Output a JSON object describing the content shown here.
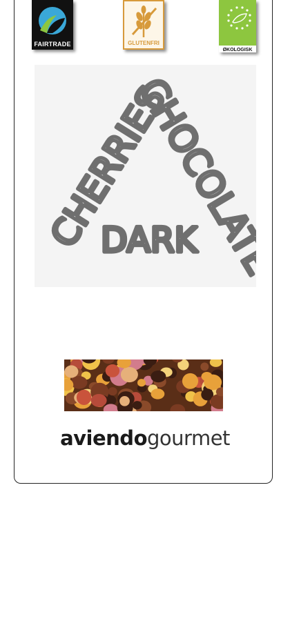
{
  "badges": {
    "fairtrade": {
      "label": "FAIRTRADE",
      "icon": "fairtrade-icon",
      "colors": {
        "background": "#111111",
        "blue": "#3aa8d8",
        "green": "#8cc63f"
      }
    },
    "glutenfree": {
      "label": "GLUTENFRI",
      "icon": "wheat-icon",
      "colors": {
        "accent": "#d79a3b"
      }
    },
    "organic": {
      "label": "ØKOLOGISK",
      "icon": "eu-leaf-icon",
      "colors": {
        "green": "#8dc63f"
      }
    }
  },
  "hero": {
    "words": {
      "left": "CHERRIES",
      "right": "CHOCOLATE",
      "bottom": "DARK"
    },
    "colors": {
      "text": "#6f6f6f",
      "panel": "#f4f4f4"
    }
  },
  "brand": {
    "strong": "aviendo",
    "light": "gourmet"
  }
}
